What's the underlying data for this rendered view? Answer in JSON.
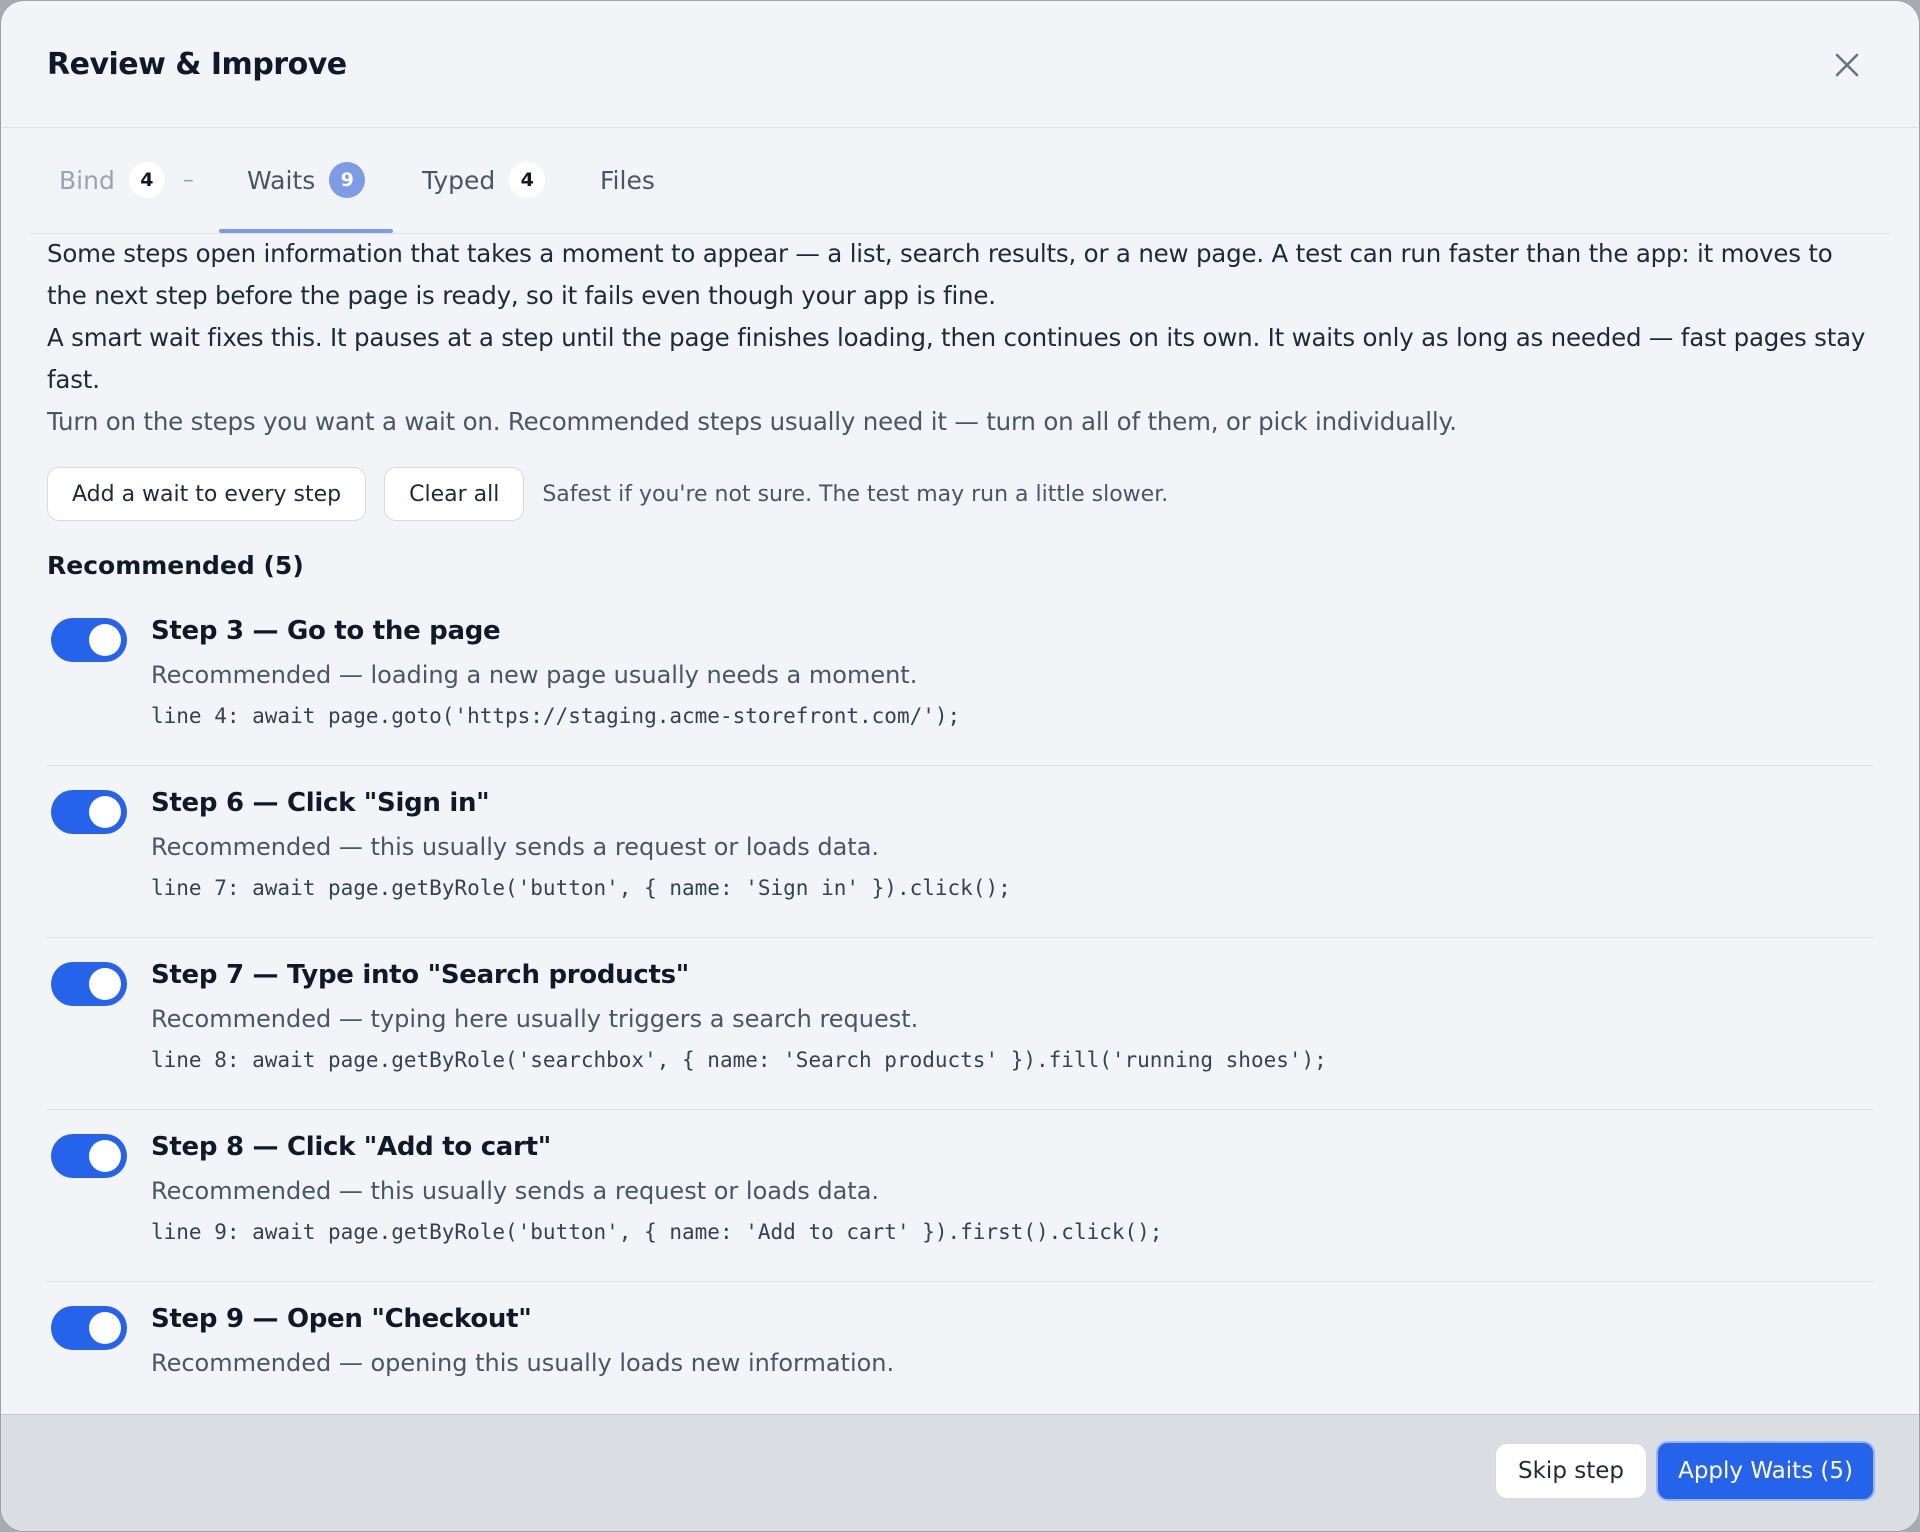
{
  "dialog": {
    "title": "Review & Improve",
    "close_icon": "close-icon"
  },
  "tabs": [
    {
      "label": "Bind",
      "count": "4",
      "suffix": "–",
      "state": "disabled"
    },
    {
      "label": "Waits",
      "count": "9",
      "state": "active"
    },
    {
      "label": "Typed",
      "count": "4",
      "state": "normal"
    },
    {
      "label": "Files",
      "state": "normal"
    }
  ],
  "intro": {
    "p1": "Some steps open information that takes a moment to appear — a list, search results, or a new page. A test can run faster than the app: it moves to the next step before the page is ready, so it fails even though your app is fine.",
    "p2": "A smart wait fixes this. It pauses at a step until the page finishes loading, then continues on its own. It waits only as long as needed — fast pages stay fast.",
    "p3": "Turn on the steps you want a wait on. Recommended steps usually need it — turn on all of them, or pick individually."
  },
  "actions": {
    "add_all_label": "Add a wait to every step",
    "clear_all_label": "Clear all",
    "hint": "Safest if you're not sure. The test may run a little slower."
  },
  "recommended": {
    "heading": "Recommended (5)",
    "steps": [
      {
        "title": "Step 3 — Go to the page",
        "reason": "Recommended — loading a new page usually needs a moment.",
        "code": "line 4: await page.goto('https://staging.acme-storefront.com/');",
        "enabled": true
      },
      {
        "title": "Step 6 — Click \"Sign in\"",
        "reason": "Recommended — this usually sends a request or loads data.",
        "code": "line 7: await page.getByRole('button', { name: 'Sign in' }).click();",
        "enabled": true
      },
      {
        "title": "Step 7 — Type into \"Search products\"",
        "reason": "Recommended — typing here usually triggers a search request.",
        "code": "line 8: await page.getByRole('searchbox', { name: 'Search products' }).fill('running shoes');",
        "enabled": true
      },
      {
        "title": "Step 8 — Click \"Add to cart\"",
        "reason": "Recommended — this usually sends a request or loads data.",
        "code": "line 9: await page.getByRole('button', { name: 'Add to cart' }).first().click();",
        "enabled": true
      },
      {
        "title": "Step 9 — Open \"Checkout\"",
        "reason": "Recommended — opening this usually loads new information.",
        "code": "",
        "enabled": true
      }
    ]
  },
  "footer": {
    "skip_label": "Skip step",
    "apply_label": "Apply Waits (5)"
  },
  "colors": {
    "accent": "#2563eb",
    "tab_accent": "#7c9ce6"
  }
}
